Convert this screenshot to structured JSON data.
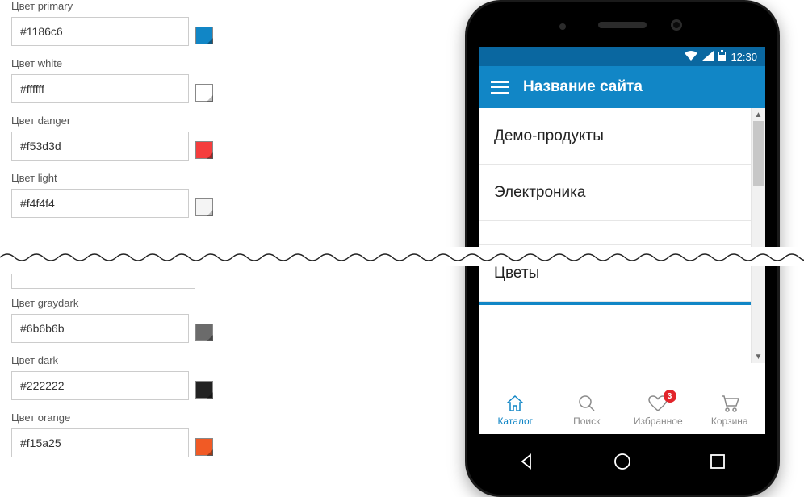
{
  "colors": {
    "primary": {
      "label": "Цвет primary",
      "value": "#1186c6",
      "swatch": "#1186c6"
    },
    "white": {
      "label": "Цвет white",
      "value": "#ffffff",
      "swatch": "#ffffff"
    },
    "danger": {
      "label": "Цвет danger",
      "value": "#f53d3d",
      "swatch": "#f53d3d"
    },
    "light": {
      "label": "Цвет light",
      "value": "#f4f4f4",
      "swatch": "#f4f4f4"
    },
    "graydark": {
      "label": "Цвет graydark",
      "value": "#6b6b6b",
      "swatch": "#6b6b6b"
    },
    "dark": {
      "label": "Цвет dark",
      "value": "#222222",
      "swatch": "#222222"
    },
    "orange": {
      "label": "Цвет orange",
      "value": "#f15a25",
      "swatch": "#f15a25"
    }
  },
  "statusbar": {
    "time": "12:30"
  },
  "appbar": {
    "title": "Название сайта"
  },
  "catalog": {
    "items": [
      "Демо-продукты",
      "Электроника",
      "Цветы"
    ]
  },
  "tabs": {
    "catalog": {
      "label": "Каталог"
    },
    "search": {
      "label": "Поиск"
    },
    "favorites": {
      "label": "Избранное",
      "badge": "3"
    },
    "cart": {
      "label": "Корзина"
    }
  }
}
